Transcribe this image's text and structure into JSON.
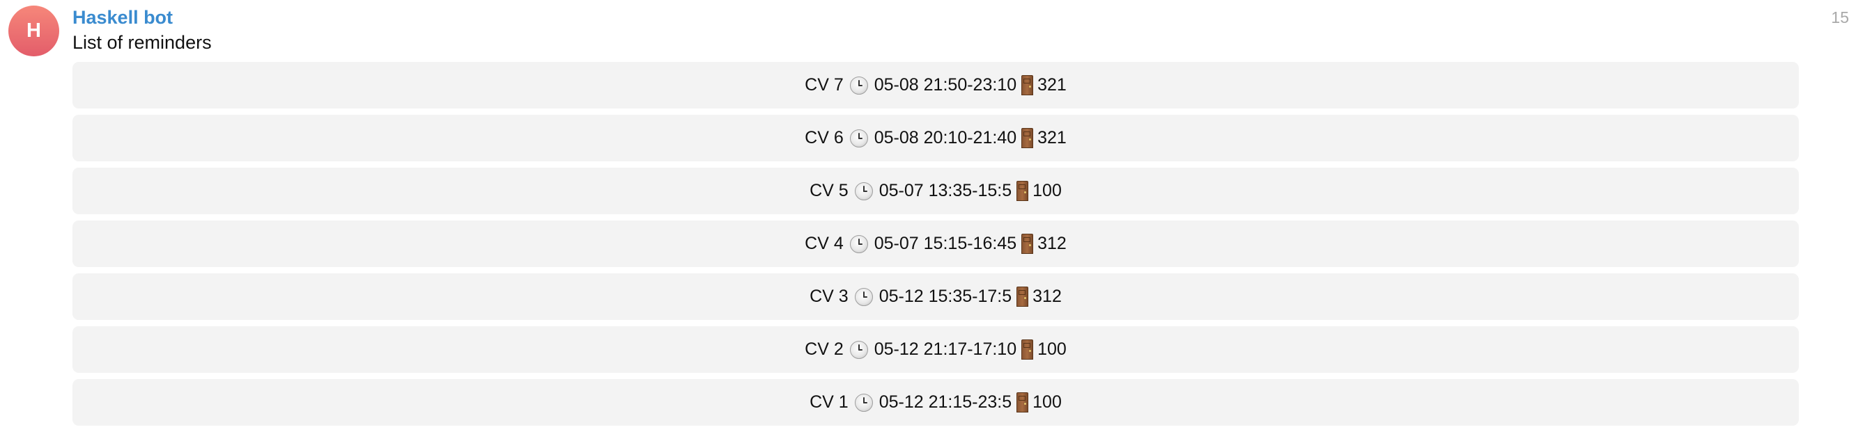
{
  "message": {
    "avatar_letter": "H",
    "sender": "Haskell bot",
    "time": "15",
    "text": "List of reminders"
  },
  "keyboard": {
    "buttons": [
      {
        "name": "CV 7",
        "date": "05-08",
        "time_range": "21:50-23:10",
        "room": "321"
      },
      {
        "name": "CV 6",
        "date": "05-08",
        "time_range": "20:10-21:40",
        "room": "321"
      },
      {
        "name": "CV 5",
        "date": "05-07",
        "time_range": "13:35-15:5",
        "room": "100"
      },
      {
        "name": "CV 4",
        "date": "05-07",
        "time_range": "15:15-16:45",
        "room": "312"
      },
      {
        "name": "CV 3",
        "date": "05-12",
        "time_range": "15:35-17:5",
        "room": "312"
      },
      {
        "name": "CV 2",
        "date": "05-12",
        "time_range": "21:17-17:10",
        "room": "100"
      },
      {
        "name": "CV 1",
        "date": "05-12",
        "time_range": "21:15-23:5",
        "room": "100"
      }
    ]
  },
  "icons": {
    "clock": "clock-icon",
    "door": "door-icon"
  },
  "colors": {
    "avatar_top": "#f6877a",
    "avatar_bottom": "#e35d6a",
    "sender_name": "#3a8bcf",
    "button_bg": "#f3f3f3",
    "timestamp": "#a9a9a9"
  }
}
